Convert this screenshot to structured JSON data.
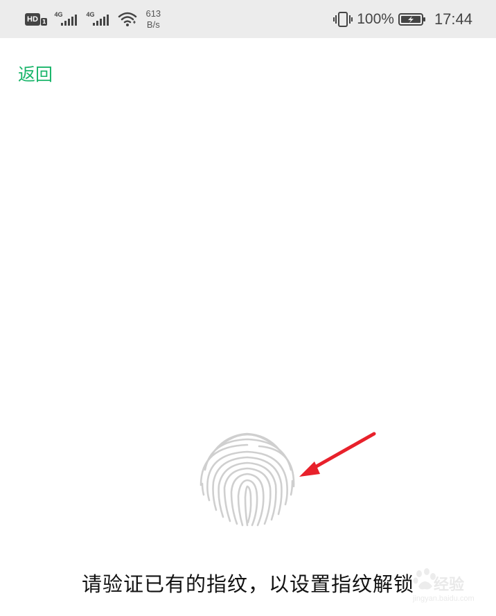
{
  "status_bar": {
    "hd_label": "HD",
    "hd_sub": "1",
    "signal1_tag": "4G",
    "signal2_tag": "4G",
    "net_speed_value": "613",
    "net_speed_unit": "B/s",
    "battery_percent": "100%",
    "time": "17:44",
    "icons": [
      "hd-volte-icon",
      "signal-4g-icon",
      "signal-4g-icon",
      "wifi-icon",
      "vibrate-icon",
      "battery-charging-icon"
    ]
  },
  "header": {
    "back_label": "返回"
  },
  "main": {
    "prompt_text": "请验证已有的指纹，以设置指纹解锁",
    "fingerprint_icon": "fingerprint-icon",
    "annotation_color": "#e8212b"
  },
  "watermark": {
    "text": "经验",
    "sub": "jingyan.baidu.com"
  },
  "colors": {
    "accent": "#19b56a",
    "status_bar_bg": "#ececec"
  }
}
